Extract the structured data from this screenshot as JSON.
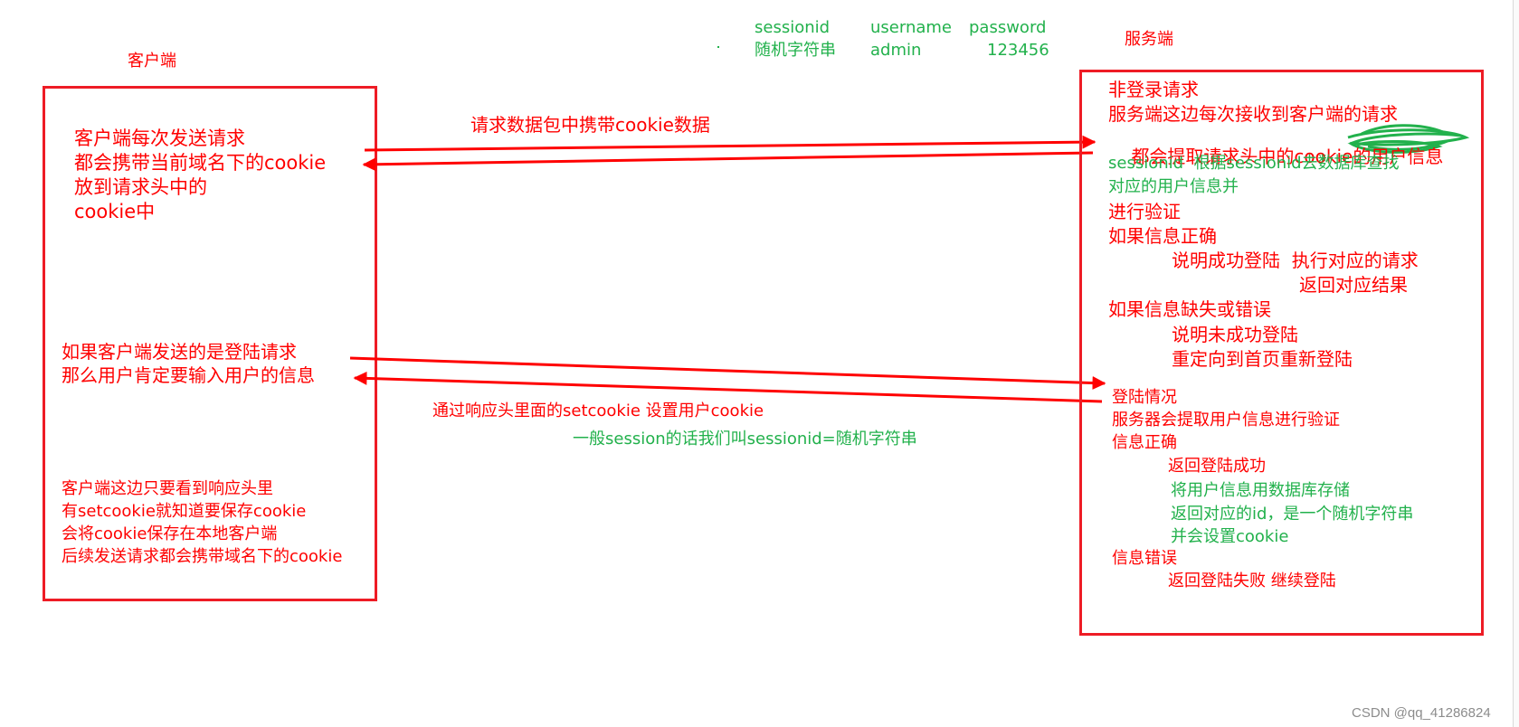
{
  "labels": {
    "client_title": "客户端",
    "server_title": "服务端"
  },
  "session_table": {
    "headers": [
      "sessionid",
      "username",
      "password"
    ],
    "row": [
      "随机字符串",
      "admin",
      "123456"
    ]
  },
  "client": {
    "block1": [
      "客户端每次发送请求",
      "都会携带当前域名下的cookie",
      "放到请求头中的",
      "cookie中"
    ],
    "block2": [
      "如果客户端发送的是登陆请求",
      "那么用户肯定要输入用户的信息"
    ],
    "block3": [
      "客户端这边只要看到响应头里",
      "有setcookie就知道要保存cookie",
      "会将cookie保存在本地客户端",
      "后续发送请求都会携带域名下的cookie"
    ]
  },
  "arrows": {
    "request_caption": "请求数据包中携带cookie数据",
    "response_caption": "通过响应头里面的setcookie 设置用户cookie",
    "session_note": "一般session的话我们叫sessionid=随机字符串"
  },
  "server": {
    "non_login": {
      "title": "非登录请求",
      "line1": "服务端这边每次接收到客户端的请求",
      "line2_visible": "都会提取请求头中的cookie的",
      "line2_obscured": "用户信息",
      "green1": "sessionid  根据sessionid去数据库查找",
      "green2": "对应的用户信息并",
      "line3": "进行验证",
      "if_correct": "如果信息正确",
      "correct_1": "说明成功登陆  执行对应的请求",
      "correct_2": "返回对应结果",
      "if_missing": "如果信息缺失或错误",
      "missing_1": "说明未成功登陆",
      "missing_2": "重定向到首页重新登陆"
    },
    "login": {
      "title": "登陆情况",
      "line1": "服务器会提取用户信息进行验证",
      "if_correct": "信息正确",
      "correct_1": "返回登陆成功",
      "green1": "将用户信息用数据库存储",
      "green2": "返回对应的id，是一个随机字符串",
      "green3": "并会设置cookie",
      "if_wrong": "信息错误",
      "wrong_1": "返回登陆失败 继续登陆"
    }
  },
  "watermark": "CSDN @qq_41286824",
  "colors": {
    "red": "#ff0000",
    "box_red": "#ee1c25",
    "green": "#22b14c",
    "watermark_gray": "#8c8c8c"
  }
}
